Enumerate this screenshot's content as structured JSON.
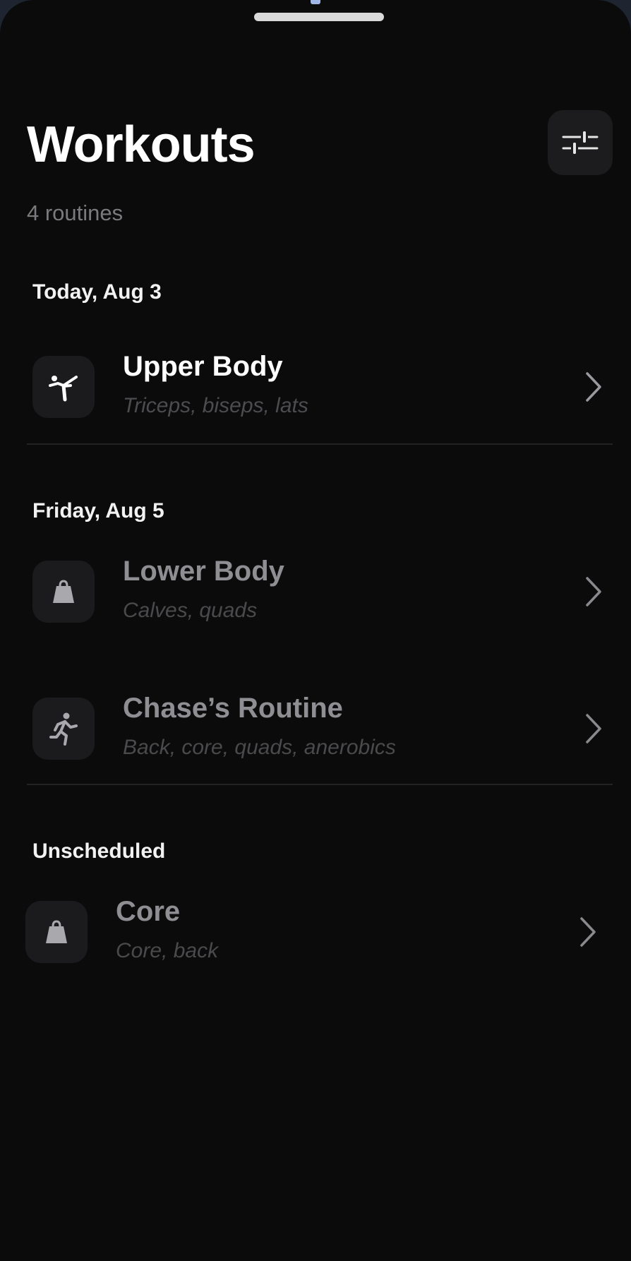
{
  "header": {
    "title": "Workouts",
    "subtitle": "4 routines",
    "filter_icon": "sliders-icon"
  },
  "sections": [
    {
      "label": "Today, Aug 3",
      "items": [
        {
          "title": "Upper Body",
          "subtitle": "Triceps, biseps, lats",
          "icon": "martial-arts-icon",
          "state": "active"
        }
      ]
    },
    {
      "label": "Friday, Aug 5",
      "items": [
        {
          "title": "Lower Body",
          "subtitle": "Calves, quads",
          "icon": "weight-icon",
          "state": "dim"
        },
        {
          "title": "Chase’s Routine",
          "subtitle": "Back, core, quads, anerobics",
          "icon": "running-icon",
          "state": "dim"
        }
      ]
    },
    {
      "label": "Unscheduled",
      "items": [
        {
          "title": "Core",
          "subtitle": "Core, back",
          "icon": "weight-icon",
          "state": "dim"
        }
      ]
    }
  ],
  "colors": {
    "background": "#0b0b0c",
    "tile": "#1b1b1d",
    "title_active": "#ffffff",
    "title_dim": "#8e8e93",
    "subtitle_text": "#4a4a4d",
    "divider": "#232325"
  }
}
